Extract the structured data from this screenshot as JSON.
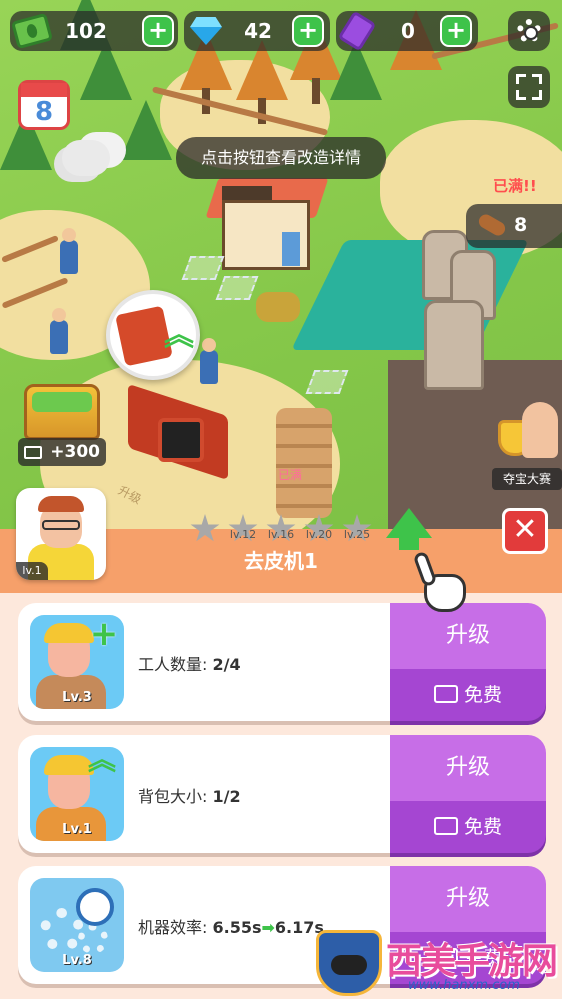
{
  "hud": {
    "cash": "102",
    "gems": "42",
    "tickets": "0",
    "plus_symbol": "+"
  },
  "calendar": {
    "day": "8"
  },
  "hint": "点击按钮查看改造详情",
  "storage": {
    "full_label": "已满!!",
    "wood_count": "8"
  },
  "world": {
    "ground_text": "升级",
    "full_floor": "已满"
  },
  "chest": {
    "reward": "+300"
  },
  "treasure_event": {
    "label": "夺宝大赛"
  },
  "machine": {
    "title": "去皮机1",
    "worker_level": "lv.1",
    "levels": [
      "lv.12",
      "lv.16",
      "lv.20",
      "lv.25"
    ]
  },
  "close_symbol": "✕",
  "cards": [
    {
      "stat_label": "工人数量: ",
      "stat_value": "2/4",
      "icon_level": "Lv.3",
      "upgrade_label": "升级",
      "free_label": "免费"
    },
    {
      "stat_label": "背包大小: ",
      "stat_value": "1/2",
      "icon_level": "Lv.1",
      "upgrade_label": "升级",
      "free_label": "免费"
    },
    {
      "stat_label": "机器效率: ",
      "stat_value_from": "6.55s",
      "stat_arrow": "➡",
      "stat_value_to": "6.17s",
      "icon_level": "Lv.8",
      "upgrade_label": "升级",
      "free_label": "免费"
    }
  ],
  "watermark": {
    "text": "西美手游网",
    "url": "www.hanxm.com"
  },
  "colors": {
    "accent_green": "#3ec34a",
    "panel_orange": "#f6a06a",
    "upgrade_purple": "#c76ee7",
    "free_purple": "#a546d2",
    "close_red": "#e23b3b"
  }
}
